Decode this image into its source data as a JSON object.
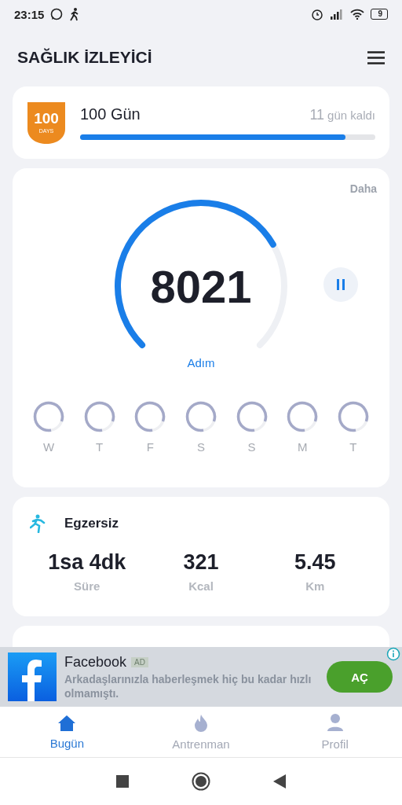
{
  "status_bar": {
    "time": "23:15",
    "battery": "9"
  },
  "header": {
    "title": "SAĞLIK İZLEYİCİ"
  },
  "challenge": {
    "badge_number": "100",
    "badge_label": "DAYS",
    "title": "100 Gün",
    "remaining_count": "11",
    "remaining_label": "gün kaldı",
    "level": 0.9
  },
  "steps": {
    "more": "Daha",
    "count": "8021",
    "unit": "Adım",
    "paused": false,
    "days": [
      {
        "label": "W"
      },
      {
        "label": "T"
      },
      {
        "label": "F"
      },
      {
        "label": "S"
      },
      {
        "label": "S"
      },
      {
        "label": "M"
      },
      {
        "label": "T"
      }
    ]
  },
  "exercise": {
    "title": "Egzersiz",
    "stats": [
      {
        "value": "1sa 4dk",
        "label": "Süre"
      },
      {
        "value": "321",
        "label": "Kcal"
      },
      {
        "value": "5.45",
        "label": "Km"
      }
    ]
  },
  "ad": {
    "title": "Facebook",
    "tag": "AD",
    "text": "Arkadaşlarınızla haberleşmek hiç bu kadar hızlı olmamıştı.",
    "button": "AÇ"
  },
  "tabs": [
    {
      "label": "Bugün",
      "kind": "home",
      "selected": true
    },
    {
      "label": "Antrenman",
      "kind": "fire",
      "selected": false
    },
    {
      "label": "Profil",
      "kind": "person",
      "selected": false
    }
  ]
}
